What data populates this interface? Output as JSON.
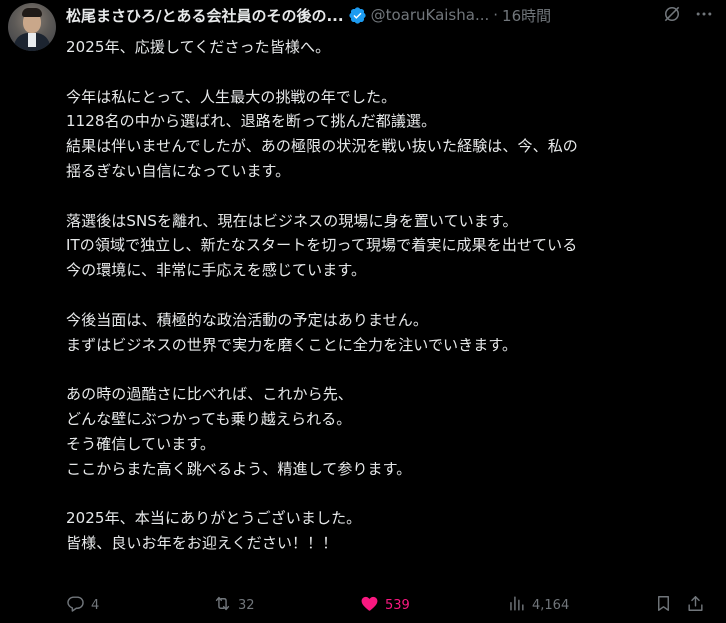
{
  "author": {
    "display_name": "松尾まさひろ/とある会社員のその後の...",
    "handle": "@toaruKaisha...",
    "separator": "·",
    "time": "16時間"
  },
  "icons": {
    "verified": "verified-badge-icon",
    "grok": "grok-icon",
    "more": "more-icon",
    "reply": "reply-icon",
    "retweet": "retweet-icon",
    "like": "heart-icon",
    "views": "views-icon",
    "bookmark": "bookmark-icon",
    "share": "share-icon"
  },
  "colors": {
    "background": "#000000",
    "text": "#e7e9ea",
    "secondary": "#71767b",
    "verified": "#1d9bf0",
    "like": "#f91880"
  },
  "body_lines": [
    "2025年、応援してくださった皆様へ。",
    "",
    "今年は私にとって、人生最大の挑戦の年でした。",
    "1128名の中から選ばれ、退路を断って挑んだ都議選。",
    "結果は伴いませんでしたが、あの極限の状況を戦い抜いた経験は、今、私の",
    "揺るぎない自信になっています。",
    "",
    "落選後はSNSを離れ、現在はビジネスの現場に身を置いています。",
    "ITの領域で独立し、新たなスタートを切って現場で着実に成果を出せている",
    "今の環境に、非常に手応えを感じています。",
    "",
    "今後当面は、積極的な政治活動の予定はありません。",
    "まずはビジネスの世界で実力を磨くことに全力を注いでいきます。",
    "",
    "あの時の過酷さに比べれば、これから先、",
    "どんな壁にぶつかっても乗り越えられる。",
    "そう確信しています。",
    "ここからまた高く跳べるよう、精進して参ります。",
    "",
    "2025年、本当にありがとうございました。",
    "皆様、良いお年をお迎えください！！！"
  ],
  "actions": {
    "replies": "4",
    "retweets": "32",
    "likes": "539",
    "views": "4,164"
  }
}
